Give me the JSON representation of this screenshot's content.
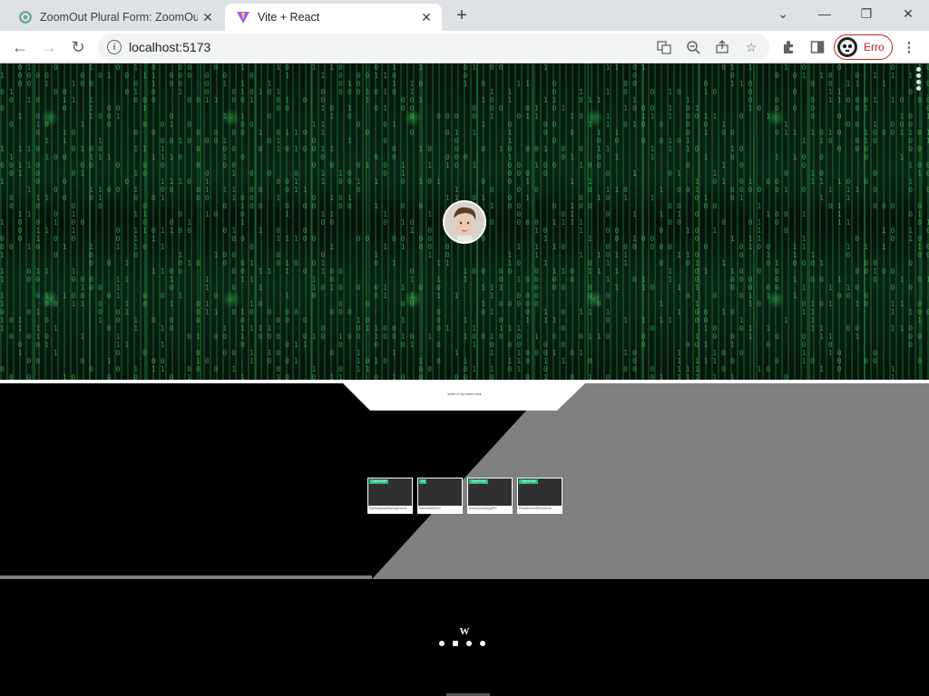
{
  "browser": {
    "tabs": [
      {
        "title": "ZoomOut Plural Form: ZoomOuts",
        "active": false
      },
      {
        "title": "Vite + React",
        "active": true
      }
    ],
    "url": "localhost:5173",
    "profile_label": "Erro",
    "new_tab_glyph": "+",
    "close_glyph": "✕",
    "window_controls": {
      "minimize": "—",
      "restore": "❐",
      "close": "✕",
      "tab_search": "⌄"
    }
  },
  "hero": {
    "background": "matrix-digital-rain",
    "accent_color": "#3ddc6f",
    "avatar": "profile-photo"
  },
  "projects_section": {
    "notch_text": "some of my recent work",
    "cards": [
      {
        "badge": "TypeScript",
        "name": "MyIndividualManagement"
      },
      {
        "badge": "C#",
        "name": "SalesWebMVC"
      },
      {
        "badge": "TypeScript",
        "name": "ReactQueryAppPD"
      },
      {
        "badge": "TypeScript",
        "name": "ReactBoundPomoEnd"
      }
    ]
  },
  "footer": {
    "logo": "W",
    "socials": [
      "instagram-icon",
      "linkedin-icon",
      "github-icon",
      "discord-icon"
    ]
  }
}
